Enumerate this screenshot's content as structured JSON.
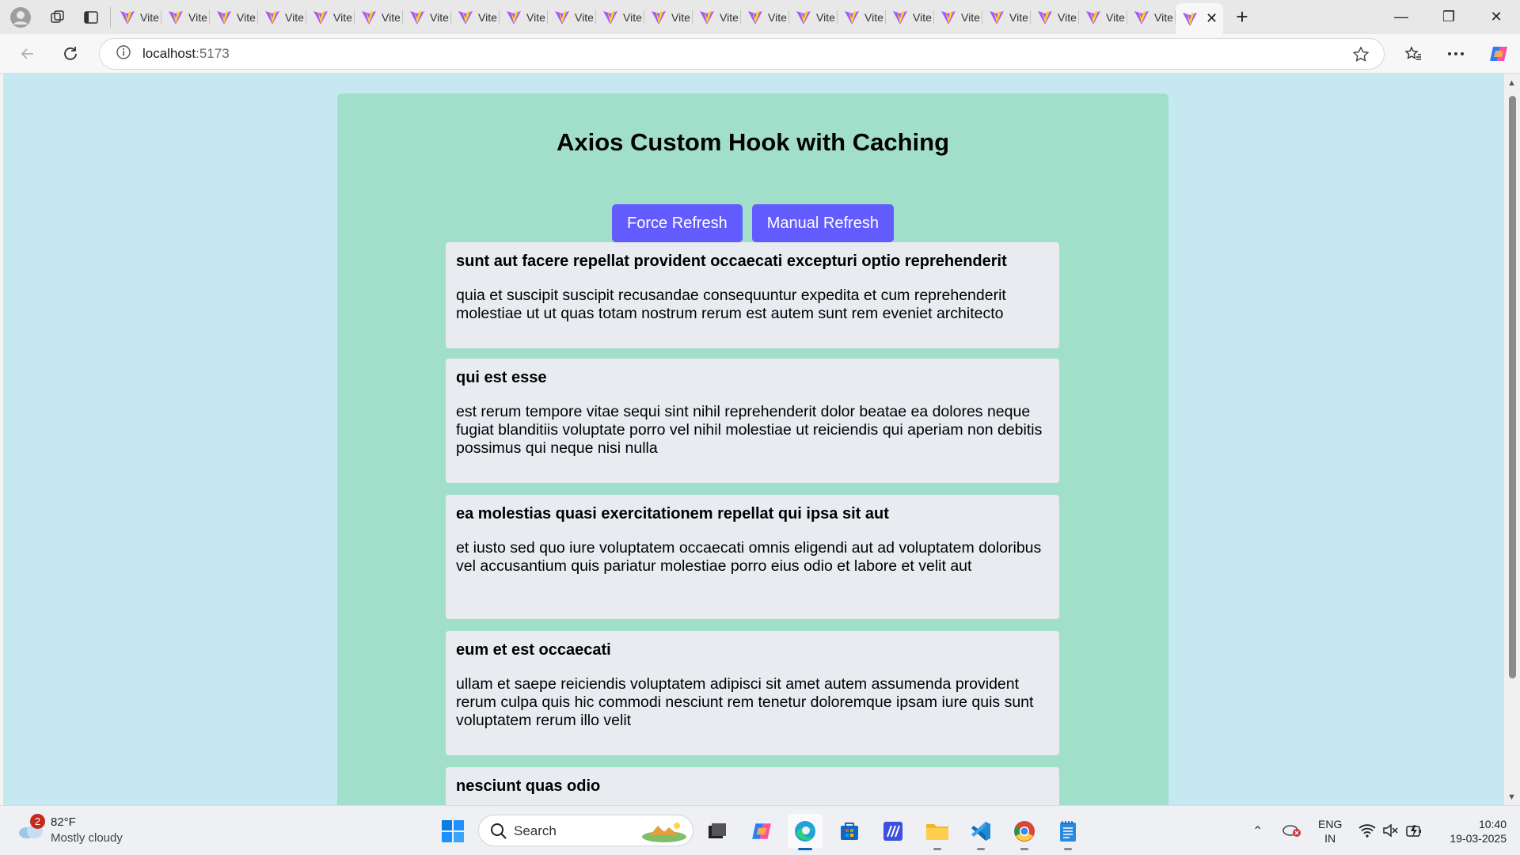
{
  "browser": {
    "tab_title": "Vite",
    "tab_count": 22,
    "url_host": "localhost",
    "url_port": ":5173"
  },
  "page": {
    "title": "Axios Custom Hook with Caching",
    "buttons": {
      "force_refresh": "Force Refresh",
      "manual_refresh": "Manual Refresh"
    },
    "posts": [
      {
        "title": "sunt aut facere repellat provident occaecati excepturi optio reprehenderit",
        "body": "quia et suscipit suscipit recusandae consequuntur expedita et cum reprehenderit molestiae ut ut quas totam nostrum rerum est autem sunt rem eveniet architecto"
      },
      {
        "title": "qui est esse",
        "body": "est rerum tempore vitae sequi sint nihil reprehenderit dolor beatae ea dolores neque fugiat blanditiis voluptate porro vel nihil molestiae ut reiciendis qui aperiam non debitis possimus qui neque nisi nulla"
      },
      {
        "title": "ea molestias quasi exercitationem repellat qui ipsa sit aut",
        "body": "et iusto sed quo iure voluptatem occaecati omnis eligendi aut ad voluptatem doloribus vel accusantium quis pariatur molestiae porro eius odio et labore et velit aut"
      },
      {
        "title": "eum et est occaecati",
        "body": "ullam et saepe reiciendis voluptatem adipisci sit amet autem assumenda provident rerum culpa quis hic commodi nesciunt rem tenetur doloremque ipsam iure quis sunt voluptatem rerum illo velit"
      },
      {
        "title": "nesciunt quas odio",
        "body": ""
      }
    ]
  },
  "taskbar": {
    "weather_badge": "2",
    "temperature": "82°F",
    "condition": "Mostly cloudy",
    "search_label": "Search",
    "lang_line1": "ENG",
    "lang_line2": "IN",
    "time": "10:40",
    "date": "19-03-2025"
  },
  "colors": {
    "page_background": "#c6e8f0",
    "container_background": "#a2dfcb",
    "button": "#625cff",
    "card": "#e8ebf0"
  }
}
